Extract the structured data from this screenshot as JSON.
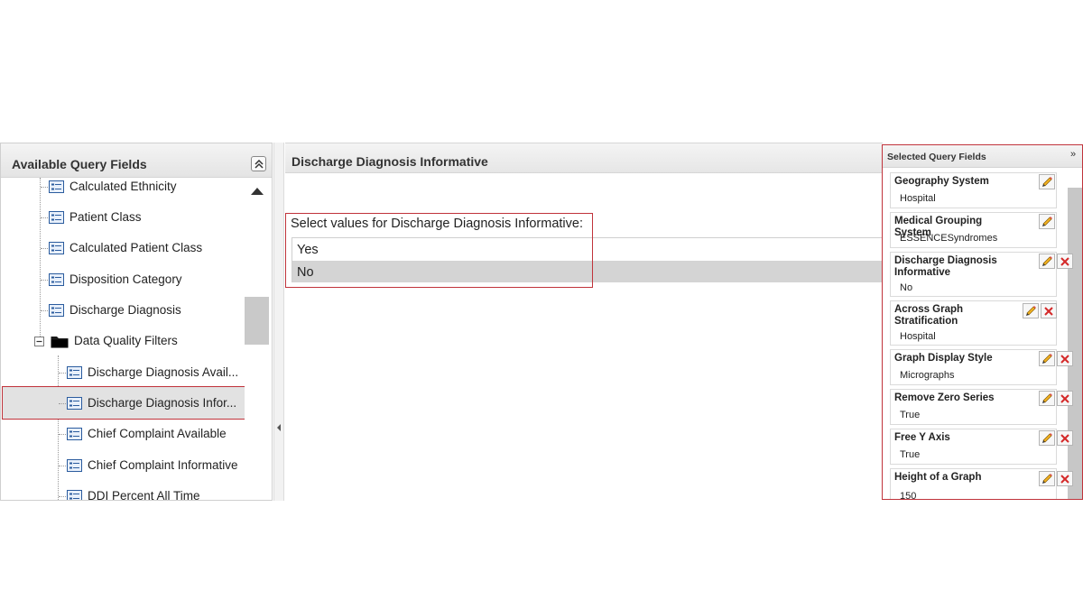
{
  "available_fields": {
    "title": "Available Query Fields",
    "items": [
      {
        "label": "Calculated Ethnicity",
        "icon": "field-icon"
      },
      {
        "label": "Patient Class",
        "icon": "field-icon"
      },
      {
        "label": "Calculated Patient Class",
        "icon": "field-icon"
      },
      {
        "label": "Disposition Category",
        "icon": "field-icon"
      },
      {
        "label": "Discharge Diagnosis",
        "icon": "field-icon"
      }
    ],
    "folder": {
      "label": "Data Quality Filters",
      "icon": "folder-icon",
      "state": "expanded"
    },
    "sub_items": [
      {
        "label": "Discharge Diagnosis Avail...",
        "icon": "field-icon"
      },
      {
        "label": "Discharge Diagnosis Infor...",
        "icon": "field-icon",
        "selected": true
      },
      {
        "label": "Chief Complaint Available",
        "icon": "field-icon"
      },
      {
        "label": "Chief Complaint Informative",
        "icon": "field-icon"
      },
      {
        "label": "DDI Percent All Time",
        "icon": "field-icon"
      }
    ]
  },
  "center": {
    "title": "Discharge Diagnosis Informative",
    "prompt": "Select values for Discharge Diagnosis Informative:",
    "values": [
      {
        "label": "Yes",
        "selected": false
      },
      {
        "label": "No",
        "selected": true
      }
    ]
  },
  "selected_fields": {
    "title": "Selected Query Fields",
    "expand_glyph": "»",
    "items": [
      {
        "name": "Geography System",
        "value": "Hospital"
      },
      {
        "name": "Medical Grouping System",
        "value": "ESSENCESyndromes"
      },
      {
        "name": "Discharge Diagnosis Informative",
        "value": "No"
      },
      {
        "name": "Across Graph Stratification",
        "value": "Hospital"
      },
      {
        "name": "Graph Display Style",
        "value": "Micrographs"
      },
      {
        "name": "Remove Zero Series",
        "value": "True"
      },
      {
        "name": "Free Y Axis",
        "value": "True"
      },
      {
        "name": "Height of a Graph",
        "value": "150"
      }
    ]
  },
  "colors": {
    "highlight": "#c0333b",
    "selected_row": "#d4d4d4",
    "field_icon": "#2b5c9e"
  }
}
